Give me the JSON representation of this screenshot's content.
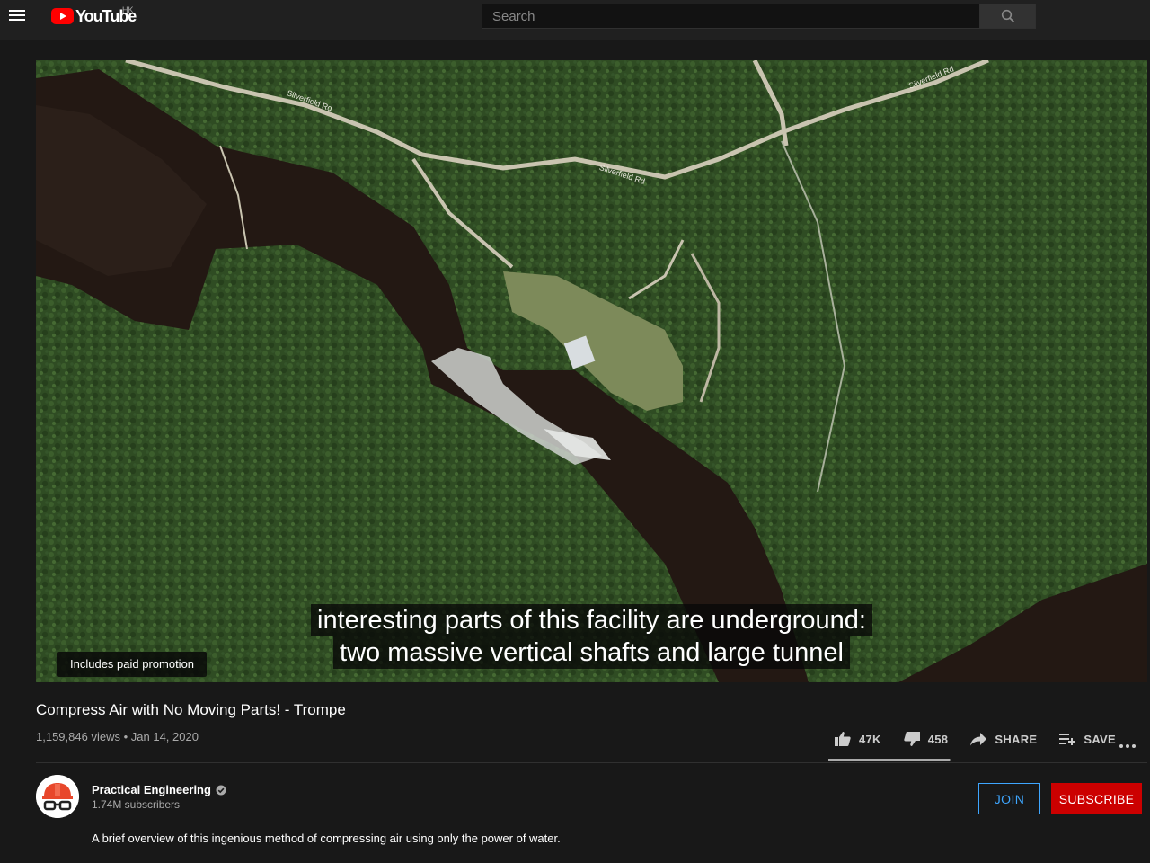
{
  "header": {
    "logo_text": "YouTube",
    "region": "HK",
    "search_placeholder": "Search"
  },
  "video": {
    "paid_promotion": "Includes paid promotion",
    "captions": [
      "interesting parts of this facility are underground:",
      "two massive vertical shafts and large tunnel"
    ],
    "map_labels": [
      "Silverfield Rd",
      "Silverfield Rd",
      "Silverfield Rd"
    ]
  },
  "info": {
    "title": "Compress Air with No Moving Parts! - Trompe",
    "views": "1,159,846 views",
    "separator": "•",
    "date": "Jan 14, 2020",
    "likes": "47K",
    "dislikes": "458",
    "share_label": "SHARE",
    "save_label": "SAVE",
    "like_ratio": 0.99
  },
  "channel": {
    "name": "Practical Engineering",
    "subscribers": "1.74M subscribers",
    "join_label": "JOIN",
    "subscribe_label": "SUBSCRIBE",
    "description": "A brief overview of this ingenious method of compressing air using only the power of water."
  },
  "icons": {
    "menu": "hamburger-menu-icon",
    "search": "search-icon",
    "like": "thumbs-up-icon",
    "dislike": "thumbs-down-icon",
    "share": "share-arrow-icon",
    "save": "playlist-add-icon",
    "more": "more-horizontal-icon",
    "verified": "verified-check-icon"
  },
  "colors": {
    "brand_red": "#ff0000",
    "subscribe_red": "#cc0000",
    "join_blue": "#3ea6ff",
    "background": "#181818"
  }
}
